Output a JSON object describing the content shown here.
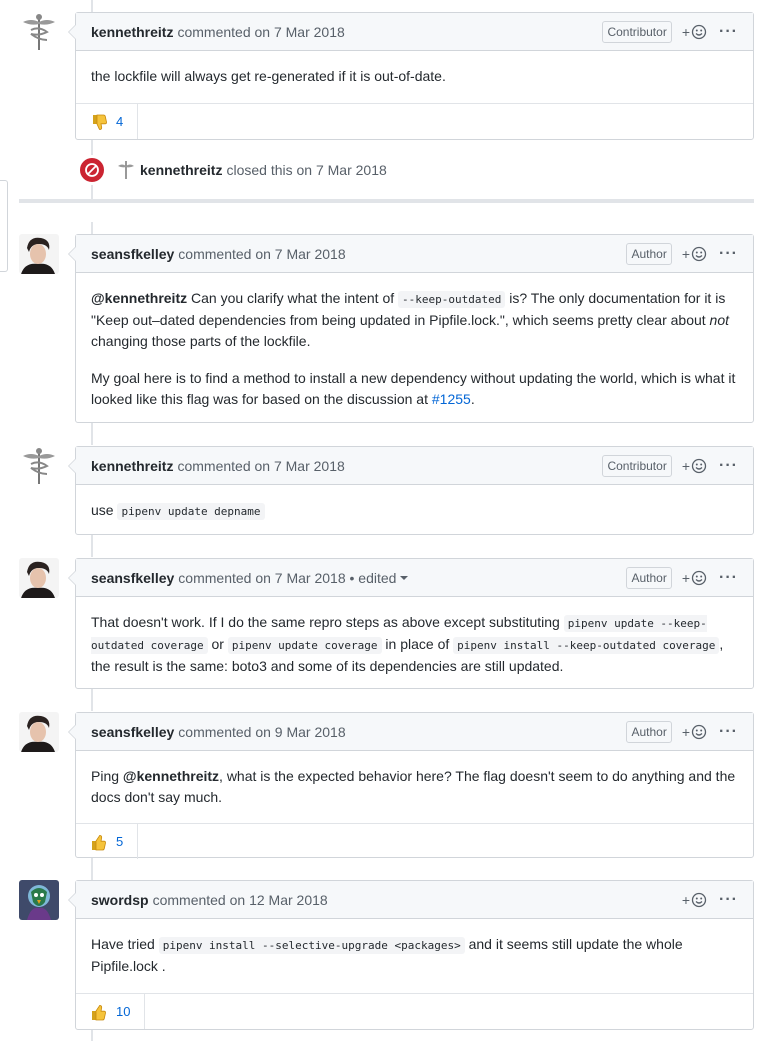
{
  "comments": [
    {
      "author": "kennethreitz",
      "meta": "commented on 7 Mar 2018",
      "badge": "Contributor",
      "body": "the lockfile will always get re-generated if it is out-of-date.",
      "reaction_count": "4",
      "reaction_icon": "thumbs-down-icon"
    },
    {
      "author": "seansfkelley",
      "meta": "commented on 7 Mar 2018",
      "badge": "Author",
      "p1_mention": "@kennethreitz",
      "p1_a": " Can you clarify what the intent of ",
      "p1_code": "--keep-outdated",
      "p1_b": " is? The only documentation for it is \"Keep out–dated dependencies from being updated in Pipfile.lock.\", which seems pretty clear about ",
      "p1_em": "not",
      "p1_c": " changing those parts of the lockfile.",
      "p2_a": "My goal here is to find a method to install a new dependency without updating the world, which is what it looked like this flag was for based on the discussion at ",
      "p2_link": "#1255",
      "p2_b": "."
    },
    {
      "author": "kennethreitz",
      "meta": "commented on 7 Mar 2018",
      "badge": "Contributor",
      "body_a": "use ",
      "body_code": "pipenv update depname"
    },
    {
      "author": "seansfkelley",
      "meta": "commented on 7 Mar 2018 • edited",
      "badge": "Author",
      "a": "That doesn't work. If I do the same repro steps as above except substituting ",
      "code1": "pipenv update --keep-outdated coverage",
      "b": " or ",
      "code2": "pipenv update coverage",
      "c": " in place of ",
      "code3": "pipenv install --keep-outdated coverage",
      "d": ", the result is the same: boto3 and some of its dependencies are still updated."
    },
    {
      "author": "seansfkelley",
      "meta": "commented on 9 Mar 2018",
      "badge": "Author",
      "a": "Ping ",
      "mention": "@kennethreitz",
      "b": ", what is the expected behavior here? The flag doesn't seem to do anything and the docs don't say much.",
      "reaction_count": "5",
      "reaction_icon": "thumbs-up-icon"
    },
    {
      "author": "swordsp",
      "meta": "commented on 12 Mar 2018",
      "a": "Have tried ",
      "code": "pipenv install --selective-upgrade <packages>",
      "b": " and it seems still update the whole Pipfile.lock .",
      "reaction_count": "10",
      "reaction_icon": "thumbs-up-icon"
    }
  ],
  "event": {
    "author": "kennethreitz",
    "meta": "closed this on 7 Mar 2018",
    "icon": "closed-circle-icon"
  },
  "colors": {
    "closed": "#cb2431",
    "link": "#0366d6",
    "header_bg": "#f6f8fa",
    "border": "#d1d5da"
  }
}
